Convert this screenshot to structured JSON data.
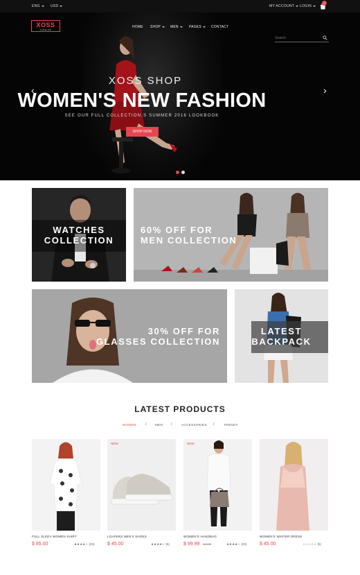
{
  "topbar": {
    "language": "ENG",
    "currency": "USD",
    "account": "MY ACCOUNT",
    "login": "LOGIN",
    "cart_count": "0"
  },
  "header": {
    "logo_main": "XOSS",
    "logo_sub": "FASHION",
    "nav": [
      "HOME",
      "SHOP",
      "MEN",
      "PAGES",
      "CONTACT"
    ],
    "search_placeholder": "Search"
  },
  "hero": {
    "subtitle": "XOSS SHOP",
    "title": "WOMEN'S NEW FASHION",
    "tagline": "SEE OUR FULL COLLECTION.S SUMMER 2016 LOOKBOOK",
    "button": "SHOP NOW",
    "prev_icon": "chevron-left-icon",
    "next_icon": "chevron-right-icon"
  },
  "banners": {
    "watches": [
      "WATCHES",
      "COLLECTION"
    ],
    "men": [
      "60% OFF FOR",
      "MEN COLLECTION"
    ],
    "glasses": [
      "30% OFF FOR",
      "GLASSES COLLECTION"
    ],
    "backpack": [
      "LATEST",
      "BACKPACK"
    ]
  },
  "products_section": {
    "title": "LATEST PRODUCTS",
    "filters": [
      "WOMEN",
      "MEN",
      "ACCESSORIES",
      "TRENDY"
    ],
    "active_filter": "WOMEN",
    "items": [
      {
        "name": "FULL SLEEV WOMEN SHIRT",
        "price": "$ 85.00",
        "old_price": "",
        "badge": "",
        "stars": "★★★★☆",
        "reviews": "(25)"
      },
      {
        "name": "LOAFERS MEN'S SHOES",
        "price": "$ 45.00",
        "old_price": "",
        "badge": "NEW",
        "stars": "★★★★☆",
        "reviews": "(5)"
      },
      {
        "name": "WOMEN'S HANDBAG",
        "price": "$ 99.99",
        "old_price": "149.00",
        "badge": "NEW",
        "stars": "★★★★☆",
        "reviews": "(25)"
      },
      {
        "name": "WOMEN'S WINTER DRESS",
        "price": "$ 45.00",
        "old_price": "",
        "badge": "",
        "stars": "☆☆☆☆☆",
        "reviews": "(5)"
      }
    ]
  },
  "colors": {
    "accent": "#e5474f",
    "dark": "#111111",
    "banner_gray": "#a9a9a9"
  }
}
